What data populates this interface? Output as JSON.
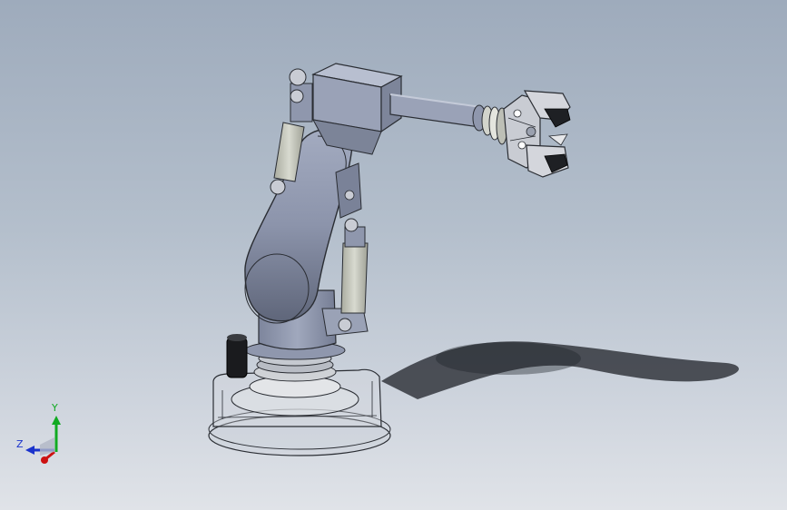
{
  "colors": {
    "background_top": "#9eabbc",
    "background_bottom": "#e0e3e8",
    "robot_body": "#8f97ad",
    "robot_body_light": "#b5bccd",
    "cylinder": "#c8cabf",
    "axis_x": "#cc1111",
    "axis_y": "#11aa22",
    "axis_z": "#1a33cc"
  },
  "triad": {
    "y_label": "Y",
    "z_label": "Z"
  }
}
